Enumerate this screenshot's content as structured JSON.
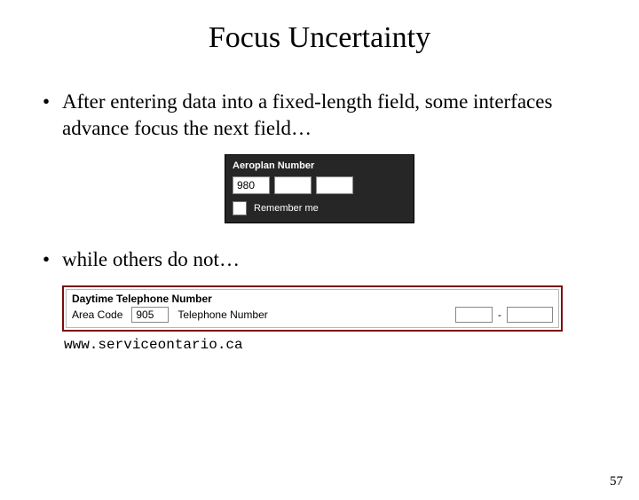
{
  "title": "Focus Uncertainty",
  "bullets": {
    "b1": "After entering data into a fixed-length field, some interfaces advance focus the next field…",
    "b2": "while others do not…"
  },
  "aeroplan": {
    "label": "Aeroplan Number",
    "seg1": "980",
    "seg2": "",
    "seg3": "",
    "remember": "Remember me"
  },
  "telephone": {
    "title": "Daytime Telephone Number",
    "area_label": "Area Code",
    "area_value": "905",
    "tel_label": "Telephone Number",
    "p1": "",
    "p2": "",
    "dash": "-"
  },
  "caption": "www.serviceontario.ca",
  "page": "57"
}
